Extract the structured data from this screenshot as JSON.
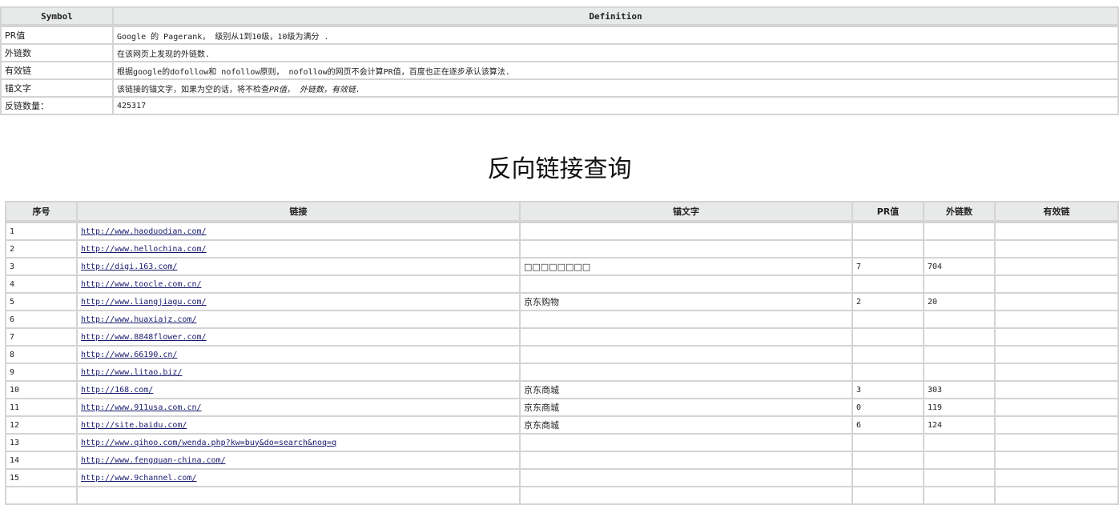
{
  "legend": {
    "headers": {
      "symbol": "Symbol",
      "definition": "Definition"
    },
    "rows": [
      {
        "symbol": "PR值",
        "definition": "Google 的 Pagerank， 级别从1到10级，10级为满分 ."
      },
      {
        "symbol": "外链数",
        "definition": "在该网页上发现的外链数."
      },
      {
        "symbol": "有效链",
        "definition": "根据google的dofollow和 nofollow原则， nofollow的网页不会计算PR值，百度也正在逐步承认该算法."
      },
      {
        "symbol": "锚文字",
        "definition": "该链接的锚文字，如果为空的话，将不检查",
        "definition_emph": "PR值， 外链数，有效链."
      },
      {
        "symbol": "反链数量：",
        "definition": "425317"
      }
    ]
  },
  "title": "反向链接查询",
  "results": {
    "headers": [
      "序号",
      "链接",
      "锚文字",
      "PR值",
      "外链数",
      "有效链"
    ],
    "rows": [
      {
        "index": "1",
        "url": "http://www.haoduodian.com/",
        "anchor": "",
        "pr": "",
        "outlinks": "",
        "valid": ""
      },
      {
        "index": "2",
        "url": "http://www.hellochina.com/",
        "anchor": "",
        "pr": "",
        "outlinks": "",
        "valid": ""
      },
      {
        "index": "3",
        "url": "http://digi.163.com/",
        "anchor": "□□□□□□□□",
        "pr": "7",
        "outlinks": "704",
        "valid": ""
      },
      {
        "index": "4",
        "url": "http://www.toocle.com.cn/",
        "anchor": "",
        "pr": "",
        "outlinks": "",
        "valid": ""
      },
      {
        "index": "5",
        "url": "http://www.liangjiagu.com/",
        "anchor": "京东购物",
        "pr": "2",
        "outlinks": "20",
        "valid": ""
      },
      {
        "index": "6",
        "url": "http://www.huaxiajz.com/",
        "anchor": "",
        "pr": "",
        "outlinks": "",
        "valid": ""
      },
      {
        "index": "7",
        "url": "http://www.8848flower.com/",
        "anchor": "",
        "pr": "",
        "outlinks": "",
        "valid": ""
      },
      {
        "index": "8",
        "url": "http://www.66190.cn/",
        "anchor": "",
        "pr": "",
        "outlinks": "",
        "valid": ""
      },
      {
        "index": "9",
        "url": "http://www.litao.biz/",
        "anchor": "",
        "pr": "",
        "outlinks": "",
        "valid": ""
      },
      {
        "index": "10",
        "url": "http://168.com/",
        "anchor": "京东商城",
        "pr": "3",
        "outlinks": "303",
        "valid": ""
      },
      {
        "index": "11",
        "url": "http://www.911usa.com.cn/",
        "anchor": "京东商城",
        "pr": "0",
        "outlinks": "119",
        "valid": ""
      },
      {
        "index": "12",
        "url": "http://site.baidu.com/",
        "anchor": "京东商城",
        "pr": "6",
        "outlinks": "124",
        "valid": ""
      },
      {
        "index": "13",
        "url": "http://www.qihoo.com/wenda.php?kw=buy&do=search&noq=q",
        "anchor": "",
        "pr": "",
        "outlinks": "",
        "valid": ""
      },
      {
        "index": "14",
        "url": "http://www.fengquan-china.com/",
        "anchor": "",
        "pr": "",
        "outlinks": "",
        "valid": ""
      },
      {
        "index": "15",
        "url": "http://www.9channel.com/",
        "anchor": "",
        "pr": "",
        "outlinks": "",
        "valid": ""
      },
      {
        "index": "",
        "url": "",
        "anchor": "",
        "pr": "",
        "outlinks": "",
        "valid": ""
      }
    ]
  }
}
